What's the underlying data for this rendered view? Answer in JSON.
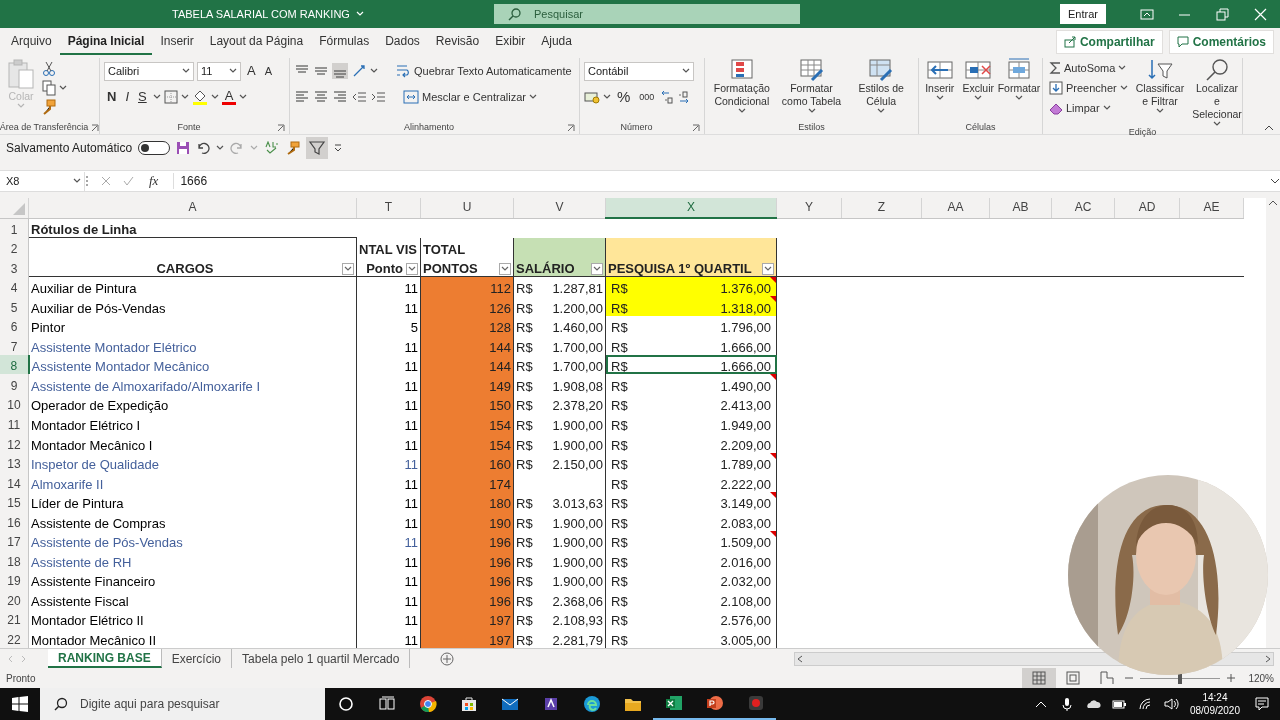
{
  "window": {
    "title": "TABELA SALARIAL COM RANKING",
    "search_placeholder": "Pesquisar",
    "sign_in": "Entrar"
  },
  "menu_tabs": [
    {
      "label": "Arquivo",
      "selected": false
    },
    {
      "label": "Página Inicial",
      "selected": true
    },
    {
      "label": "Inserir",
      "selected": false
    },
    {
      "label": "Layout da Página",
      "selected": false
    },
    {
      "label": "Fórmulas",
      "selected": false
    },
    {
      "label": "Dados",
      "selected": false
    },
    {
      "label": "Revisão",
      "selected": false
    },
    {
      "label": "Exibir",
      "selected": false
    },
    {
      "label": "Ajuda",
      "selected": false
    }
  ],
  "share_button": "Compartilhar",
  "comments_button": "Comentários",
  "ribbon": {
    "clipboard": {
      "label": "Área de Transferência",
      "paste": "Colar",
      "paste_disabled": true
    },
    "font": {
      "label": "Fonte",
      "name": "Calibri",
      "size": "11",
      "grow": "A",
      "shrink": "A",
      "bold": "N",
      "italic": "I",
      "underline": "S",
      "color_letter": "A"
    },
    "alignment": {
      "label": "Alinhamento",
      "wrap": "Quebrar Texto Automaticamente",
      "merge": "Mesclar e Centralizar"
    },
    "number": {
      "label": "Número",
      "format": "Contábil",
      "percent": "%",
      "thousands": "000"
    },
    "styles": {
      "label": "Estilos",
      "buttons": [
        "Formatação Condicional",
        "Formatar como Tabela",
        "Estilos de Célula"
      ]
    },
    "cells": {
      "label": "Células",
      "buttons": [
        "Inserir",
        "Excluir",
        "Formatar"
      ]
    },
    "editing": {
      "label": "Edição",
      "autosum": "AutoSoma",
      "fill": "Preencher",
      "clear": "Limpar",
      "sort": "Classificar e Filtrar",
      "find": "Localizar e Selecionar"
    }
  },
  "quick_access": {
    "autosave_label": "Salvamento Automático",
    "autosave_on": false
  },
  "formula_bar": {
    "name_box": "X8",
    "fx": "fx",
    "formula": "1666"
  },
  "sheet": {
    "columns": [
      {
        "label": "A",
        "selected": false
      },
      {
        "label": "T",
        "selected": false
      },
      {
        "label": "U",
        "selected": false
      },
      {
        "label": "V",
        "selected": false
      },
      {
        "label": "X",
        "selected": true
      },
      {
        "label": "Y",
        "selected": false
      },
      {
        "label": "Z",
        "selected": false
      },
      {
        "label": "AA",
        "selected": false
      },
      {
        "label": "AB",
        "selected": false
      },
      {
        "label": "AC",
        "selected": false
      },
      {
        "label": "AD",
        "selected": false
      },
      {
        "label": "AE",
        "selected": false
      }
    ],
    "header_row_numbers": [
      "1",
      "2",
      "3"
    ],
    "title": "Rótulos de Linha",
    "labels_row_2": [
      "NTAL VIS",
      "TOTAL"
    ],
    "labels_row_3": [
      "CARGOS",
      "Ponto",
      "PONTOS",
      "SALÁRIO",
      "PESQUISA 1º QUARTIL"
    ],
    "rows": [
      {
        "n": "4",
        "cargo": {
          "text": "Auxiliar de Pintura",
          "color": "#000000"
        },
        "pontos": {
          "text": "11",
          "color": "#000000"
        },
        "total": "112",
        "salario_currency": "R$",
        "salario": "1.287,81",
        "pesquisa_currency": "R$",
        "pesquisa": "1.376,00",
        "highlighted": true,
        "comment": true,
        "selected": false
      },
      {
        "n": "5",
        "cargo": {
          "text": "Auxiliar de Pós-Vendas",
          "color": "#000000"
        },
        "pontos": {
          "text": "11",
          "color": "#000000"
        },
        "total": "126",
        "salario_currency": "R$",
        "salario": "1.200,00",
        "pesquisa_currency": "R$",
        "pesquisa": "1.318,00",
        "highlighted": true,
        "comment": true,
        "selected": false
      },
      {
        "n": "6",
        "cargo": {
          "text": "Pintor",
          "color": "#000000"
        },
        "pontos": {
          "text": "5",
          "color": "#000000"
        },
        "total": "128",
        "salario_currency": "R$",
        "salario": "1.460,00",
        "pesquisa_currency": "R$",
        "pesquisa": "1.796,00",
        "highlighted": false,
        "comment": false,
        "selected": false
      },
      {
        "n": "7",
        "cargo": {
          "text": "Assistente Montador Elétrico",
          "color": "#44609b"
        },
        "pontos": {
          "text": "11",
          "color": "#000000"
        },
        "total": "144",
        "salario_currency": "R$",
        "salario": "1.700,00",
        "pesquisa_currency": "R$",
        "pesquisa": "1.666,00",
        "highlighted": false,
        "comment": false,
        "selected": false
      },
      {
        "n": "8",
        "cargo": {
          "text": "Assistente Montador Mecânico",
          "color": "#44609b"
        },
        "pontos": {
          "text": "11",
          "color": "#000000"
        },
        "total": "144",
        "salario_currency": "R$",
        "salario": "1.700,00",
        "pesquisa_currency": "R$",
        "pesquisa": "1.666,00",
        "highlighted": false,
        "comment": false,
        "selected": true
      },
      {
        "n": "9",
        "cargo": {
          "text": "Assistente de Almoxarifado/Almoxarife I",
          "color": "#44609b"
        },
        "pontos": {
          "text": "11",
          "color": "#000000"
        },
        "total": "149",
        "salario_currency": "R$",
        "salario": "1.908,08",
        "pesquisa_currency": "R$",
        "pesquisa": "1.490,00",
        "highlighted": false,
        "comment": true,
        "selected": false
      },
      {
        "n": "10",
        "cargo": {
          "text": "Operador de Expedição",
          "color": "#000000"
        },
        "pontos": {
          "text": "11",
          "color": "#000000"
        },
        "total": "150",
        "salario_currency": "R$",
        "salario": "2.378,20",
        "pesquisa_currency": "R$",
        "pesquisa": "2.413,00",
        "highlighted": false,
        "comment": false,
        "selected": false
      },
      {
        "n": "11",
        "cargo": {
          "text": "Montador Elétrico I",
          "color": "#000000"
        },
        "pontos": {
          "text": "11",
          "color": "#000000"
        },
        "total": "154",
        "salario_currency": "R$",
        "salario": "1.900,00",
        "pesquisa_currency": "R$",
        "pesquisa": "1.949,00",
        "highlighted": false,
        "comment": false,
        "selected": false
      },
      {
        "n": "12",
        "cargo": {
          "text": "Montador Mecânico I",
          "color": "#000000"
        },
        "pontos": {
          "text": "11",
          "color": "#000000"
        },
        "total": "154",
        "salario_currency": "R$",
        "salario": "1.900,00",
        "pesquisa_currency": "R$",
        "pesquisa": "2.209,00",
        "highlighted": false,
        "comment": false,
        "selected": false
      },
      {
        "n": "13",
        "cargo": {
          "text": "Inspetor de Qualidade",
          "color": "#44609b"
        },
        "pontos": {
          "text": "11",
          "color": "#44609b"
        },
        "total": "160",
        "salario_currency": "R$",
        "salario": "2.150,00",
        "pesquisa_currency": "R$",
        "pesquisa": "1.789,00",
        "highlighted": false,
        "comment": true,
        "selected": false
      },
      {
        "n": "14",
        "cargo": {
          "text": "Almoxarife II",
          "color": "#44609b"
        },
        "pontos": {
          "text": "11",
          "color": "#000000"
        },
        "total": "174",
        "pesquisa_currency": "R$",
        "pesquisa": "2.222,00",
        "highlighted": false,
        "comment": false,
        "selected": false
      },
      {
        "n": "15",
        "cargo": {
          "text": "Líder de Pintura",
          "color": "#000000"
        },
        "pontos": {
          "text": "11",
          "color": "#000000"
        },
        "total": "180",
        "salario_currency": "R$",
        "salario": "3.013,63",
        "pesquisa_currency": "R$",
        "pesquisa": "3.149,00",
        "highlighted": false,
        "comment": true,
        "selected": false
      },
      {
        "n": "16",
        "cargo": {
          "text": "Assistente de Compras",
          "color": "#000000"
        },
        "pontos": {
          "text": "11",
          "color": "#000000"
        },
        "total": "190",
        "salario_currency": "R$",
        "salario": "1.900,00",
        "pesquisa_currency": "R$",
        "pesquisa": "2.083,00",
        "highlighted": false,
        "comment": false,
        "selected": false
      },
      {
        "n": "17",
        "cargo": {
          "text": "Assistente de Pós-Vendas",
          "color": "#44609b"
        },
        "pontos": {
          "text": "11",
          "color": "#44609b"
        },
        "total": "196",
        "salario_currency": "R$",
        "salario": "1.900,00",
        "pesquisa_currency": "R$",
        "pesquisa": "1.509,00",
        "highlighted": false,
        "comment": true,
        "selected": false
      },
      {
        "n": "18",
        "cargo": {
          "text": "Assistente de RH",
          "color": "#44609b"
        },
        "pontos": {
          "text": "11",
          "color": "#000000"
        },
        "total": "196",
        "salario_currency": "R$",
        "salario": "1.900,00",
        "pesquisa_currency": "R$",
        "pesquisa": "2.016,00",
        "highlighted": false,
        "comment": false,
        "selected": false
      },
      {
        "n": "19",
        "cargo": {
          "text": "Assistente Financeiro",
          "color": "#000000"
        },
        "pontos": {
          "text": "11",
          "color": "#000000"
        },
        "total": "196",
        "salario_currency": "R$",
        "salario": "1.900,00",
        "pesquisa_currency": "R$",
        "pesquisa": "2.032,00",
        "highlighted": false,
        "comment": false,
        "selected": false
      },
      {
        "n": "20",
        "cargo": {
          "text": "Assistente Fiscal",
          "color": "#000000"
        },
        "pontos": {
          "text": "11",
          "color": "#000000"
        },
        "total": "196",
        "salario_currency": "R$",
        "salario": "2.368,06",
        "pesquisa_currency": "R$",
        "pesquisa": "2.108,00",
        "highlighted": false,
        "comment": false,
        "selected": false
      },
      {
        "n": "21",
        "cargo": {
          "text": "Montador Elétrico II",
          "color": "#000000"
        },
        "pontos": {
          "text": "11",
          "color": "#000000"
        },
        "total": "197",
        "salario_currency": "R$",
        "salario": "2.108,93",
        "pesquisa_currency": "R$",
        "pesquisa": "2.576,00",
        "highlighted": false,
        "comment": false,
        "selected": false
      },
      {
        "n": "22",
        "cargo": {
          "text": "Montador Mecânico II",
          "color": "#000000"
        },
        "pontos": {
          "text": "11",
          "color": "#000000"
        },
        "total": "197",
        "salario_currency": "R$",
        "salario": "2.281,79",
        "pesquisa_currency": "R$",
        "pesquisa": "3.005,00",
        "highlighted": false,
        "comment": false,
        "selected": false
      }
    ]
  },
  "sheet_tabs": [
    {
      "label": "RANKING BASE",
      "selected": true
    },
    {
      "label": "Exercício",
      "selected": false
    },
    {
      "label": "Tabela pelo 1 quartil Mercado",
      "selected": false
    }
  ],
  "status_bar": {
    "status": "Pronto",
    "views": [
      {
        "kind": "normal",
        "selected": true
      },
      {
        "kind": "page_layout",
        "selected": false
      },
      {
        "kind": "page_break",
        "selected": false
      }
    ],
    "zoom": {
      "level": 0.5,
      "label": "120%"
    }
  },
  "taskbar": {
    "search_placeholder": "Digite aqui para pesquisar",
    "apps": [
      {
        "kind": "cortana",
        "running": false
      },
      {
        "kind": "task_view",
        "running": false
      },
      {
        "kind": "chrome",
        "running": false
      },
      {
        "kind": "store",
        "running": false
      },
      {
        "kind": "mail",
        "running": false
      },
      {
        "kind": "purple_app",
        "running": false
      },
      {
        "kind": "edge",
        "running": false
      },
      {
        "kind": "folder",
        "running": false
      },
      {
        "kind": "excel",
        "running": true
      },
      {
        "kind": "powerpoint",
        "running": true
      },
      {
        "kind": "recorder",
        "running": true
      }
    ],
    "time": "14:24",
    "date": "08/09/2020"
  }
}
